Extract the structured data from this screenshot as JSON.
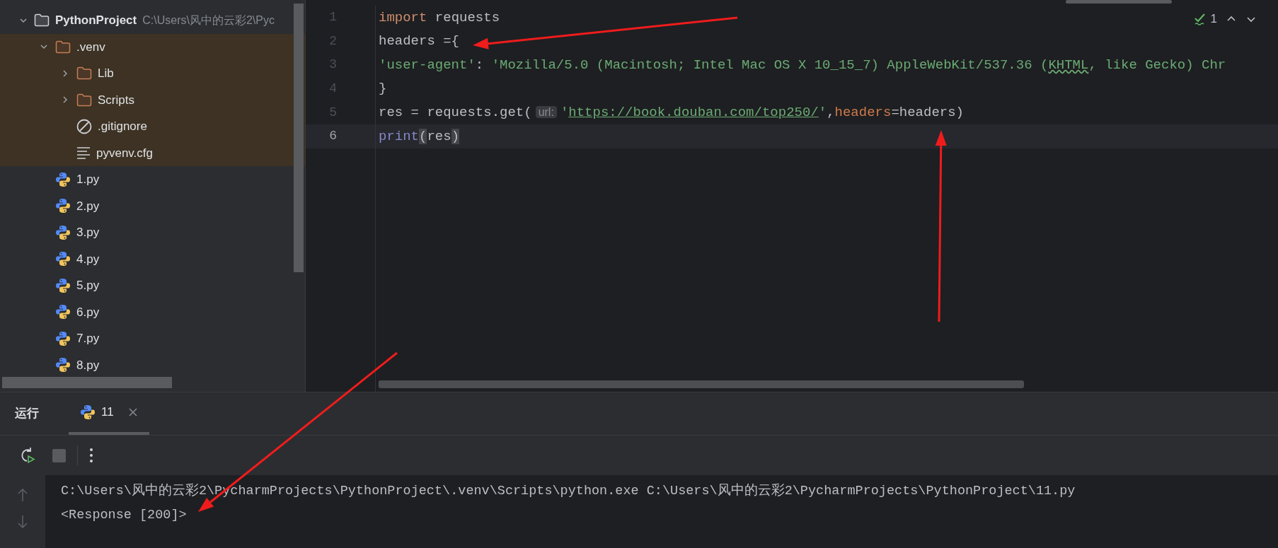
{
  "project_tree": {
    "name": "PythonProject",
    "path": "C:\\Users\\风中的云彩2\\Pyc",
    "expanded": true,
    "children": [
      {
        "name": ".venv",
        "kind": "folder",
        "expanded": true,
        "excluded": true,
        "children": [
          {
            "name": "Lib",
            "kind": "folder",
            "expanded": false
          },
          {
            "name": "Scripts",
            "kind": "folder",
            "expanded": false
          },
          {
            "name": ".gitignore",
            "kind": "ignore"
          },
          {
            "name": "pyvenv.cfg",
            "kind": "config"
          }
        ]
      },
      {
        "name": "1.py",
        "kind": "python"
      },
      {
        "name": "2.py",
        "kind": "python"
      },
      {
        "name": "3.py",
        "kind": "python"
      },
      {
        "name": "4.py",
        "kind": "python"
      },
      {
        "name": "5.py",
        "kind": "python"
      },
      {
        "name": "6.py",
        "kind": "python"
      },
      {
        "name": "7.py",
        "kind": "python"
      },
      {
        "name": "8.py",
        "kind": "python"
      }
    ]
  },
  "editor": {
    "inspection_count": "1",
    "lines": [
      {
        "number": "1",
        "current": false,
        "tokens": [
          {
            "kind": "keyword",
            "text": "import"
          },
          {
            "kind": "plain",
            "text": " requests"
          }
        ]
      },
      {
        "number": "2",
        "current": false,
        "tokens": [
          {
            "kind": "plain",
            "text": "headers ={"
          }
        ]
      },
      {
        "number": "3",
        "current": false,
        "tokens": [
          {
            "kind": "string",
            "text": "'user-agent'"
          },
          {
            "kind": "plain",
            "text": ": "
          },
          {
            "kind": "string",
            "text": "'Mozilla/5.0 (Macintosh; Intel Mac OS X 10_15_7) AppleWebKit/537.36 ("
          },
          {
            "kind": "typo",
            "text": "KHTML"
          },
          {
            "kind": "string",
            "text": ", like Gecko) Chr"
          }
        ]
      },
      {
        "number": "4",
        "current": false,
        "tokens": [
          {
            "kind": "plain",
            "text": "}"
          }
        ]
      },
      {
        "number": "5",
        "current": false,
        "tokens": [
          {
            "kind": "plain",
            "text": "res = requests.get("
          },
          {
            "kind": "inlay",
            "text": "url:"
          },
          {
            "kind": "string",
            "text": "'"
          },
          {
            "kind": "url",
            "text": "https://book.douban.com/top250/"
          },
          {
            "kind": "string",
            "text": "'"
          },
          {
            "kind": "plain",
            "text": ","
          },
          {
            "kind": "param",
            "text": "headers"
          },
          {
            "kind": "plain",
            "text": "=headers)"
          }
        ]
      },
      {
        "number": "6",
        "current": true,
        "tokens": [
          {
            "kind": "builtin",
            "text": "print"
          },
          {
            "kind": "match",
            "text": "("
          },
          {
            "kind": "plain",
            "text": "res"
          },
          {
            "kind": "match",
            "text": ")"
          }
        ]
      }
    ]
  },
  "run_panel": {
    "title": "运行",
    "tabs": [
      {
        "label": "11",
        "selected": true
      }
    ],
    "console": [
      "C:\\Users\\风中的云彩2\\PycharmProjects\\PythonProject\\.venv\\Scripts\\python.exe C:\\Users\\风中的云彩2\\PycharmProjects\\PythonProject\\11.py",
      "<Response [200]>"
    ]
  }
}
